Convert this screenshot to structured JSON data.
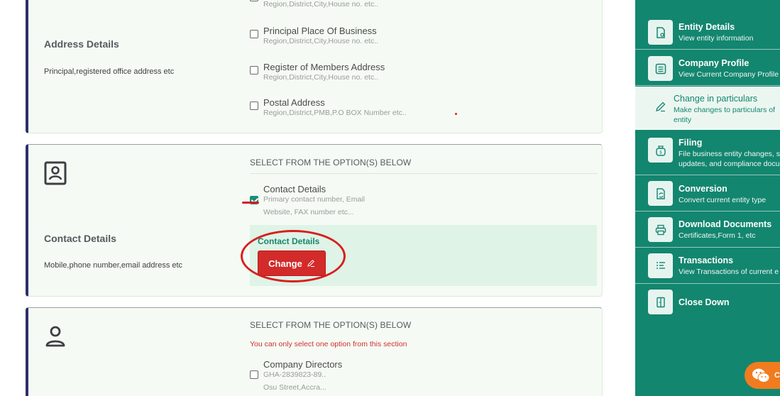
{
  "address_section": {
    "title": "Address Details",
    "description": "Principal,registered office address etc",
    "options": [
      {
        "label": "",
        "sub": "Region,District,City,House no. etc..",
        "checked": false
      },
      {
        "label": "Principal Place Of Business",
        "sub": "Region,District,City,House no. etc..",
        "checked": false
      },
      {
        "label": "Register of Members Address",
        "sub": "Region,District,City,House no. etc..",
        "checked": false
      },
      {
        "label": "Postal Address",
        "sub": "Region,District,PMB,P.O BOX Number etc..",
        "checked": false
      }
    ]
  },
  "contact_section": {
    "title": "Contact Details",
    "description": "Mobile,phone number,email address etc",
    "select_heading": "SELECT FROM THE OPTION(S) BELOW",
    "option": {
      "label": "Contact Details",
      "sub_line1": "Primary contact number, Email",
      "sub_line2": "Website, FAX number etc...",
      "checked": true
    },
    "change_panel": {
      "title": "Contact Details",
      "button_label": "Change"
    }
  },
  "directors_section": {
    "select_heading": "SELECT FROM THE OPTION(S) BELOW",
    "warning": "You can only select one option from this section",
    "option": {
      "label": "Company Directors",
      "sub_line1": "GHA-2839823-89..",
      "sub_line2": "Osu Street,Accra...",
      "checked": false
    }
  },
  "sidebar": {
    "items": [
      {
        "title": "Entity Details",
        "sub": "View entity information",
        "icon": "document-eye-icon"
      },
      {
        "title": "Company Profile",
        "sub": "View Current Company Profile",
        "icon": "list-icon"
      },
      {
        "title": "Change in particulars",
        "sub_line1": "Make changes to particulars of",
        "sub_line2": "entity",
        "icon": "pencil-icon",
        "active": true
      },
      {
        "title": "Filing",
        "sub_line1": "File business entity changes, s",
        "sub_line2": "updates, and compliance docu",
        "icon": "money-bag-icon"
      },
      {
        "title": "Conversion",
        "sub": "Convert current entity type",
        "icon": "file-convert-icon"
      },
      {
        "title": "Download Documents",
        "sub": "Certificates,Form 1, etc",
        "icon": "printer-icon"
      },
      {
        "title": "Transactions",
        "sub": "View Transactions of current e",
        "icon": "list-lines-icon"
      },
      {
        "title": "Close Down",
        "icon": "door-icon"
      }
    ]
  },
  "chat": {
    "label": "C"
  },
  "colors": {
    "sidebar": "#13866f",
    "accent_red": "#d32a2a",
    "card_border": "#2e2f6e",
    "annotation_red": "#d61f1f"
  }
}
